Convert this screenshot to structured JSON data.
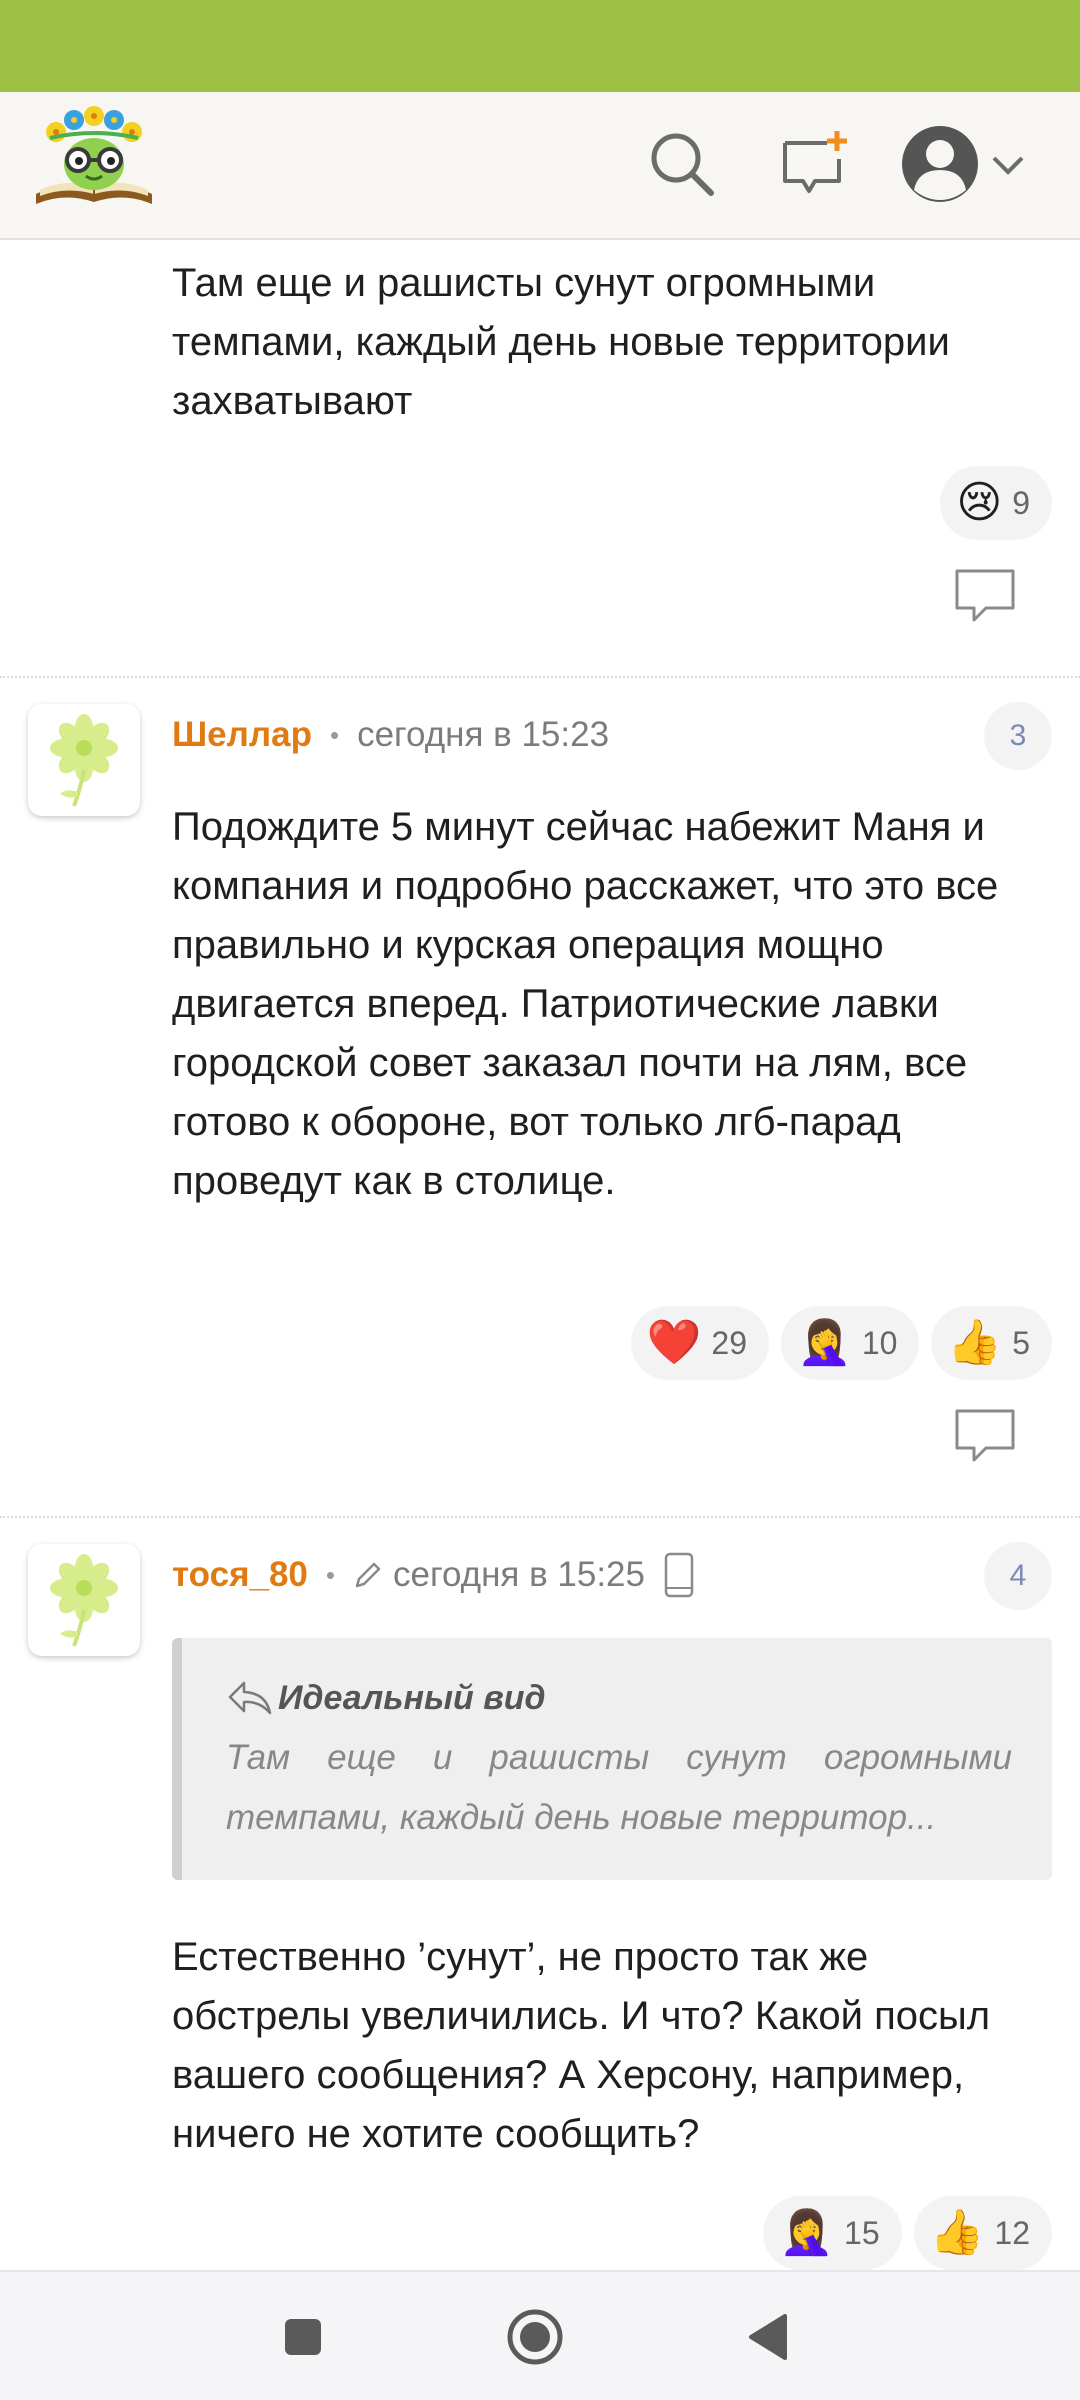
{
  "header": {
    "logo_icon": "book-flower-glasses-logo",
    "search_icon": "search-icon",
    "new_post_icon": "new-message-icon",
    "account_icon": "user-avatar-icon"
  },
  "posts": [
    {
      "text": "Там еще и рашисты сунут огромными темпами, каждый день новые территории захватывают",
      "reactions": [
        {
          "emoji": "😢",
          "count": "9"
        }
      ]
    },
    {
      "author": "Шеллар",
      "time": "сегодня в 15:23",
      "number": "3",
      "text": "Подождите 5 минут сейчас набежит Маня и компания и подробно расскажет, что это все правильно и курская операция мощно двигается вперед. Патриотические лавки городской совет заказал почти на лям, все готово к обороне, вот только лгб-парад проведут как в столице.",
      "reactions": [
        {
          "emoji": "❤️",
          "count": "29"
        },
        {
          "emoji": "🤦‍♀️",
          "count": "10"
        },
        {
          "emoji": "👍",
          "count": "5"
        }
      ]
    },
    {
      "author": "тося_80",
      "time": "сегодня в 15:25",
      "number": "4",
      "quote": {
        "author": "Идеальный вид",
        "text": "Там еще и рашисты сунут огромными темпами, каждый день новые территор..."
      },
      "text": "Естественно ’сунут’, не просто так же обстрелы увеличились. И что? Какой посыл вашего сообщения? А Херсону, например, ничего не хотите сообщить?",
      "reactions": [
        {
          "emoji": "🤦‍♀️",
          "count": "15"
        },
        {
          "emoji": "👍",
          "count": "12"
        }
      ]
    }
  ],
  "colors": {
    "status_bar": "#9dc045",
    "author": "#e07a12",
    "post_number": "#7b88b8"
  }
}
